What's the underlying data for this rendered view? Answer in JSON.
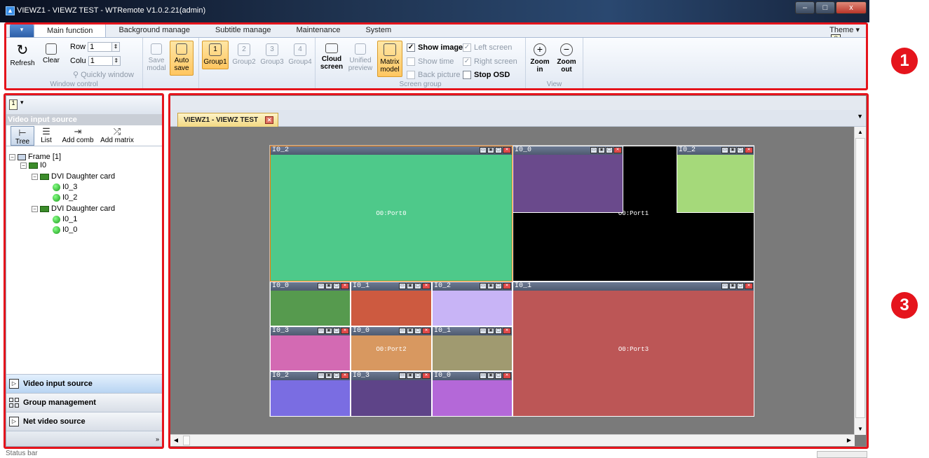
{
  "window": {
    "title": "VIEWZ1 - VIEWZ TEST - WTRemote V1.0.2.21(admin)",
    "logo": "app-logo-icon",
    "minimize": "–",
    "maximize": "□",
    "close": "x"
  },
  "ribbon": {
    "app_button": "▾",
    "tabs": [
      "Main function",
      "Background manage",
      "Subtitle manage",
      "Maintenance",
      "System"
    ],
    "active_tab": 0,
    "theme_label": "Theme",
    "theme_swatch": "S",
    "window_control": {
      "refresh": "Refresh",
      "clear": "Clear",
      "row_label": "Row",
      "row_value": "1",
      "col_label": "Colu",
      "col_value": "1",
      "quickly_window": "Quickly window",
      "group_label": "Window control"
    },
    "modal": {
      "save_modal": "Save modal",
      "auto_save": "Auto save"
    },
    "groups": {
      "items": [
        "Group1",
        "Group2",
        "Group3",
        "Group4"
      ],
      "numbers": [
        "1",
        "2",
        "3",
        "4"
      ],
      "active": 0
    },
    "screen_group": {
      "cloud_screen": "Cloud screen",
      "unified_preview": "Unified preview",
      "matrix_model": "Matrix model",
      "label": "Screen group"
    },
    "options": {
      "show_image": {
        "label": "Show image",
        "checked": true,
        "enabled": true
      },
      "show_time": {
        "label": "Show time",
        "checked": false,
        "enabled": false
      },
      "back_picture": {
        "label": "Back picture",
        "checked": false,
        "enabled": false
      },
      "left_screen": {
        "label": "Left screen",
        "checked": true,
        "enabled": false
      },
      "right_screen": {
        "label": "Right screen",
        "checked": true,
        "enabled": false
      },
      "stop_osd": {
        "label": "Stop OSD",
        "checked": false,
        "enabled": true
      }
    },
    "view": {
      "zoom_in": "Zoom in",
      "zoom_out": "Zoom out",
      "label": "View"
    }
  },
  "left_panel": {
    "top_icon": "1",
    "header": "Video input source",
    "tools": [
      "Tree",
      "List",
      "Add comb",
      "Add matrix"
    ],
    "active_tool": 0,
    "tree": [
      {
        "label": "Frame [1]",
        "icon": "frame-icon",
        "level": 0
      },
      {
        "label": "I0",
        "icon": "board-icon",
        "level": 1
      },
      {
        "label": "DVI Daughter card",
        "icon": "card-icon",
        "level": 2
      },
      {
        "label": "I0_3",
        "icon": "signal-dot-icon",
        "level": 3
      },
      {
        "label": "I0_2",
        "icon": "signal-dot-icon",
        "level": 3
      },
      {
        "label": "DVI Daughter card",
        "icon": "card-icon",
        "level": 2
      },
      {
        "label": "I0_1",
        "icon": "signal-dot-icon",
        "level": 3
      },
      {
        "label": "I0_0",
        "icon": "signal-dot-icon",
        "level": 3
      }
    ],
    "nav": [
      "Video input source",
      "Group management",
      "Net video source"
    ],
    "active_nav": 0
  },
  "document_tab": {
    "title": "VIEWZ1 - VIEWZ TEST"
  },
  "canvas": {
    "ports": [
      "O0:Port0",
      "O0:Port1",
      "O0:Port2",
      "O0:Port3"
    ],
    "windows": [
      {
        "title": "I0_2",
        "color": "#4ec98a"
      },
      {
        "title": "I0_0",
        "color": "#6a4a8c"
      },
      {
        "title": "I0_2",
        "color": "#a5d97a"
      },
      {
        "title": "I0_0",
        "color": "#569a4e"
      },
      {
        "title": "I0_1",
        "color": "#cd5a40"
      },
      {
        "title": "I0_2",
        "color": "#c8b4f6"
      },
      {
        "title": "I0_3",
        "color": "#d36ab3"
      },
      {
        "title": "I0_0",
        "color": "#d89860"
      },
      {
        "title": "I0_1",
        "color": "#a09a70"
      },
      {
        "title": "I0_2",
        "color": "#7a6de2"
      },
      {
        "title": "I0_3",
        "color": "#5e4488"
      },
      {
        "title": "I0_0",
        "color": "#b468d8"
      },
      {
        "title": "I0_1",
        "color": "#bc5656"
      }
    ]
  },
  "annotations": [
    "1",
    "3"
  ],
  "status": {
    "text": "Status bar"
  },
  "colors": {
    "accent_red": "#e5141c",
    "canvas_bg": "#7a7a7a"
  }
}
